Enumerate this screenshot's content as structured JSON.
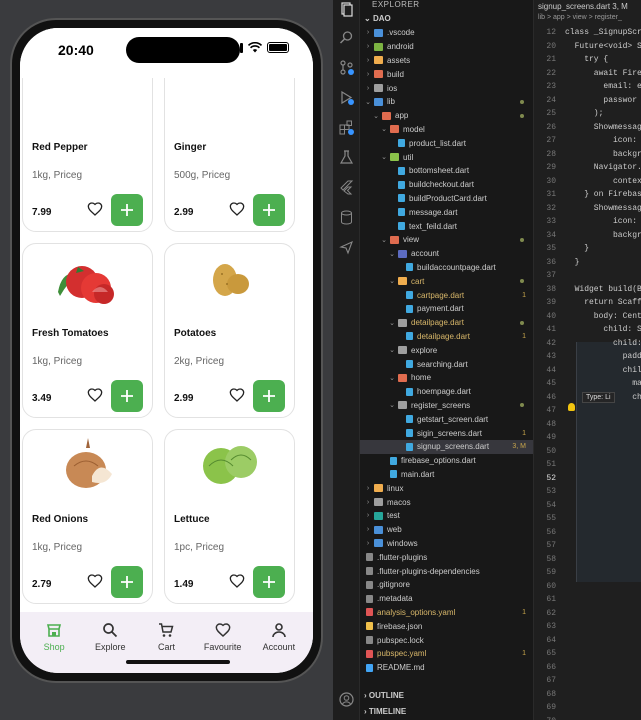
{
  "phone": {
    "time": "20:40",
    "products": [
      {
        "name": "Red Pepper",
        "sub": "1kg, Priceg",
        "price": "7.99",
        "img": "pepper"
      },
      {
        "name": "Ginger",
        "sub": "500g, Priceg",
        "price": "2.99",
        "img": "ginger"
      },
      {
        "name": "Fresh Tomatoes",
        "sub": "1kg, Priceg",
        "price": "3.49",
        "img": "tomatoes"
      },
      {
        "name": "Potatoes",
        "sub": "2kg, Priceg",
        "price": "2.99",
        "img": "potatoes"
      },
      {
        "name": "Red Onions",
        "sub": "1kg, Priceg",
        "price": "2.79",
        "img": "onion"
      },
      {
        "name": "Lettuce",
        "sub": "1pc, Priceg",
        "price": "1.49",
        "img": "lettuce"
      }
    ],
    "nav": [
      {
        "label": "Shop",
        "icon": "shop-icon",
        "active": true
      },
      {
        "label": "Explore",
        "icon": "search-icon",
        "active": false
      },
      {
        "label": "Cart",
        "icon": "cart-icon",
        "active": false
      },
      {
        "label": "Favourite",
        "icon": "heart-icon",
        "active": false
      },
      {
        "label": "Account",
        "icon": "person-icon",
        "active": false
      }
    ],
    "accent": "#4caf50"
  },
  "vscode": {
    "explorer_title": "EXPLORER",
    "root": "DAO",
    "tree": [
      {
        "label": ".vscode",
        "depth": 1,
        "type": "folder",
        "color": "#4a90d9"
      },
      {
        "label": "android",
        "depth": 1,
        "type": "folder",
        "color": "#7cb342"
      },
      {
        "label": "assets",
        "depth": 1,
        "type": "folder",
        "color": "#f0ad4e"
      },
      {
        "label": "build",
        "depth": 1,
        "type": "folder",
        "color": "#e06c4f"
      },
      {
        "label": "ios",
        "depth": 1,
        "type": "folder",
        "color": "#9e9e9e"
      },
      {
        "label": "lib",
        "depth": 1,
        "type": "folder",
        "color": "#4a90d9",
        "open": true,
        "dot": true
      },
      {
        "label": "app",
        "depth": 2,
        "type": "folder",
        "color": "#e06c4f",
        "open": true,
        "dot": true
      },
      {
        "label": "model",
        "depth": 3,
        "type": "folder",
        "color": "#e06c4f",
        "open": true
      },
      {
        "label": "product_list.dart",
        "depth": 4,
        "type": "file"
      },
      {
        "label": "util",
        "depth": 3,
        "type": "folder",
        "color": "#8bc34a",
        "open": true
      },
      {
        "label": "bottomsheet.dart",
        "depth": 4,
        "type": "file"
      },
      {
        "label": "buildcheckout.dart",
        "depth": 4,
        "type": "file"
      },
      {
        "label": "buildProductCard.dart",
        "depth": 4,
        "type": "file"
      },
      {
        "label": "message.dart",
        "depth": 4,
        "type": "file"
      },
      {
        "label": "text_feild.dart",
        "depth": 4,
        "type": "file"
      },
      {
        "label": "view",
        "depth": 3,
        "type": "folder",
        "color": "#e06c4f",
        "open": true,
        "dot": true
      },
      {
        "label": "account",
        "depth": 4,
        "type": "folder",
        "color": "#5c6bc0",
        "open": true
      },
      {
        "label": "buildaccountpage.dart",
        "depth": 5,
        "type": "file"
      },
      {
        "label": "cart",
        "depth": 4,
        "type": "folder",
        "color": "#f0ad4e",
        "open": true,
        "modified": true,
        "dot": true
      },
      {
        "label": "cartpage.dart",
        "depth": 5,
        "type": "file",
        "modified": true,
        "badge": "1"
      },
      {
        "label": "payment.dart",
        "depth": 5,
        "type": "file"
      },
      {
        "label": "detailpage.dart",
        "depth": 4,
        "type": "folder",
        "color": "#9e9e9e",
        "open": true,
        "modified": true,
        "dot": true
      },
      {
        "label": "detailpage.dart",
        "depth": 5,
        "type": "file",
        "modified": true,
        "badge": "1"
      },
      {
        "label": "explore",
        "depth": 4,
        "type": "folder",
        "color": "#9e9e9e",
        "open": true
      },
      {
        "label": "searching.dart",
        "depth": 5,
        "type": "file"
      },
      {
        "label": "home",
        "depth": 4,
        "type": "folder",
        "color": "#e06c4f",
        "open": true
      },
      {
        "label": "hoempage.dart",
        "depth": 5,
        "type": "file"
      },
      {
        "label": "register_screens",
        "depth": 4,
        "type": "folder",
        "color": "#9e9e9e",
        "open": true,
        "dot": true
      },
      {
        "label": "getstart_screen.dart",
        "depth": 5,
        "type": "file"
      },
      {
        "label": "sigin_screens.dart",
        "depth": 5,
        "type": "file",
        "badge": "1"
      },
      {
        "label": "signup_screens.dart",
        "depth": 5,
        "type": "file",
        "selected": true,
        "badge": "3, M"
      },
      {
        "label": "firebase_options.dart",
        "depth": 3,
        "type": "file"
      },
      {
        "label": "main.dart",
        "depth": 3,
        "type": "file"
      },
      {
        "label": "linux",
        "depth": 1,
        "type": "folder",
        "color": "#f0ad4e"
      },
      {
        "label": "macos",
        "depth": 1,
        "type": "folder",
        "color": "#9e9e9e"
      },
      {
        "label": "test",
        "depth": 1,
        "type": "folder",
        "color": "#26a69a"
      },
      {
        "label": "web",
        "depth": 1,
        "type": "folder",
        "color": "#4a90d9"
      },
      {
        "label": "windows",
        "depth": 1,
        "type": "folder",
        "color": "#4a90d9"
      },
      {
        "label": ".flutter-plugins",
        "depth": 1,
        "type": "plain"
      },
      {
        "label": ".flutter-plugins-dependencies",
        "depth": 1,
        "type": "plain"
      },
      {
        "label": ".gitignore",
        "depth": 1,
        "type": "plain"
      },
      {
        "label": ".metadata",
        "depth": 1,
        "type": "plain"
      },
      {
        "label": "analysis_options.yaml",
        "depth": 1,
        "type": "plain",
        "badge": "1",
        "modified": true
      },
      {
        "label": "firebase.json",
        "depth": 1,
        "type": "plain"
      },
      {
        "label": "pubspec.lock",
        "depth": 1,
        "type": "plain"
      },
      {
        "label": "pubspec.yaml",
        "depth": 1,
        "type": "plain",
        "badge": "1",
        "modified": true
      },
      {
        "label": "README.md",
        "depth": 1,
        "type": "plain"
      }
    ],
    "outline": "OUTLINE",
    "timeline": "TIMELINE",
    "tab": "signup_screens.dart 3, M",
    "breadcrumb": "lib > app > view > register_",
    "hover_tip": "Type: Li",
    "lines": [
      {
        "n": "12",
        "t": "class _SignupScr"
      },
      {
        "n": "20",
        "t": "  Future<void> S"
      },
      {
        "n": "21",
        "t": "    try {"
      },
      {
        "n": "22",
        "t": "      await Fire"
      },
      {
        "n": "23",
        "t": "        email: e"
      },
      {
        "n": "24",
        "t": "        passwor"
      },
      {
        "n": "25",
        "t": "      );"
      },
      {
        "n": "26",
        "t": "      Showmessag"
      },
      {
        "n": "27",
        "t": "          icon:"
      },
      {
        "n": "28",
        "t": "          backgr"
      },
      {
        "n": "29",
        "t": "      Navigator."
      },
      {
        "n": "30",
        "t": "          contex"
      },
      {
        "n": "31",
        "t": "    } on Firebas"
      },
      {
        "n": "32",
        "t": "      Showmessag"
      },
      {
        "n": "33",
        "t": "          icon:"
      },
      {
        "n": "34",
        "t": "          backgr"
      },
      {
        "n": "35",
        "t": "    }"
      },
      {
        "n": "36",
        "t": "  }"
      },
      {
        "n": "37",
        "t": ""
      },
      {
        "n": "38",
        "t": "  Widget build(B"
      },
      {
        "n": "39",
        "t": "    return Scaff"
      },
      {
        "n": "40",
        "t": "      body: Cent"
      },
      {
        "n": "41",
        "t": "        child: S"
      },
      {
        "n": "42",
        "t": "          child:"
      },
      {
        "n": "43",
        "t": "            padd"
      },
      {
        "n": "44",
        "t": "            chil"
      },
      {
        "n": "45",
        "t": "              ma"
      },
      {
        "n": "46",
        "t": "              ch"
      },
      {
        "n": "47",
        "t": ""
      },
      {
        "n": "48",
        "t": ""
      },
      {
        "n": "49",
        "t": ""
      },
      {
        "n": "50",
        "t": ""
      },
      {
        "n": "51",
        "t": ""
      },
      {
        "n": "52",
        "t": ""
      },
      {
        "n": "53",
        "t": ""
      },
      {
        "n": "54",
        "t": ""
      },
      {
        "n": "55",
        "t": ""
      },
      {
        "n": "56",
        "t": ""
      },
      {
        "n": "57",
        "t": ""
      },
      {
        "n": "58",
        "t": ""
      },
      {
        "n": "59",
        "t": ""
      },
      {
        "n": "60",
        "t": ""
      },
      {
        "n": "61",
        "t": ""
      },
      {
        "n": "62",
        "t": ""
      },
      {
        "n": "63",
        "t": ""
      },
      {
        "n": "64",
        "t": ""
      },
      {
        "n": "65",
        "t": ""
      },
      {
        "n": "66",
        "t": ""
      },
      {
        "n": "67",
        "t": ""
      },
      {
        "n": "68",
        "t": ""
      },
      {
        "n": "69",
        "t": ""
      },
      {
        "n": "70",
        "t": ""
      }
    ]
  }
}
